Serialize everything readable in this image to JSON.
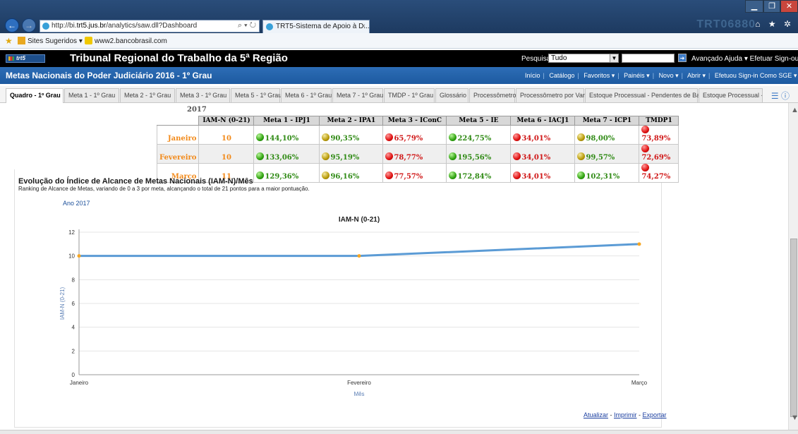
{
  "browser": {
    "url_prefix": "http://bi.",
    "url_domain": "trt5.jus.br",
    "url_rest": "/analytics/saw.dll?Dashboard",
    "url_controls": "⌕ ▾ ↻",
    "tab_title": "TRT5-Sistema de Apoio à D...",
    "tab_close": "×",
    "ghost_text": "TRT06880",
    "window_controls": {
      "minimize": "▁",
      "maximize": "❐",
      "close": "✕"
    },
    "toolbar_icons": "⌂ ★ ✲",
    "favorites": [
      "Sites Sugeridos ▾",
      "www2.bancobrasil.com"
    ]
  },
  "app_header": {
    "logo": "trt5",
    "title": "Tribunal Regional do Trabalho da 5ª Região",
    "search_label": "Pesquisar",
    "search_scope": "Tudo",
    "links": "Avançado   Ajuda ▾   Efetuar Sign-out"
  },
  "sub_header": {
    "title": "Metas Nacionais do Poder Judiciário 2016 - 1º Grau",
    "menu": [
      "Início",
      "Catálogo",
      "Favoritos ▾",
      "Painéis ▾",
      "Novo ▾",
      "Abrir ▾",
      "Efetuou Sign-in Como SGE ▾"
    ]
  },
  "tabs": [
    "Quadro - 1º Grau",
    "Meta 1 - 1º Grau",
    "Meta 2 - 1º Grau",
    "Meta 3 - 1º Grau",
    "Meta 5 - 1º Grau",
    "Meta 6 - 1º Grau",
    "Meta 7 - 1º Grau",
    "TMDP - 1º Grau",
    "Glossário",
    "Processômetro",
    "Processômetro por Vara",
    "Estoque Processual - Pendentes de Baixa",
    "Estoque Processual - I»"
  ],
  "pivot": {
    "year": "2017",
    "headers": [
      "IAM-N (0-21)",
      "Meta 1 - IPJ1",
      "Meta 2 - IPA1",
      "Meta 3 - IConC",
      "Meta 5 - IE",
      "Meta 6 - IACJ1",
      "Meta 7 - ICP1",
      "TMDP1"
    ],
    "rows": [
      {
        "month": "Janeiro",
        "iam": "10",
        "cells": [
          {
            "v": "144,10%",
            "c": "green"
          },
          {
            "v": "90,35%",
            "c": "yellow"
          },
          {
            "v": "65,79%",
            "c": "red"
          },
          {
            "v": "224,75%",
            "c": "green"
          },
          {
            "v": "34,01%",
            "c": "red"
          },
          {
            "v": "98,00%",
            "c": "yellow"
          },
          {
            "v": "73,89%",
            "c": "red"
          }
        ]
      },
      {
        "month": "Fevereiro",
        "iam": "10",
        "cells": [
          {
            "v": "133,06%",
            "c": "green"
          },
          {
            "v": "95,19%",
            "c": "yellow"
          },
          {
            "v": "78,77%",
            "c": "red"
          },
          {
            "v": "195,56%",
            "c": "green"
          },
          {
            "v": "34,01%",
            "c": "red"
          },
          {
            "v": "99,57%",
            "c": "yellow"
          },
          {
            "v": "72,69%",
            "c": "red"
          }
        ]
      },
      {
        "month": "Março",
        "iam": "11",
        "cells": [
          {
            "v": "129,36%",
            "c": "green"
          },
          {
            "v": "96,16%",
            "c": "yellow"
          },
          {
            "v": "77,57%",
            "c": "red"
          },
          {
            "v": "172,84%",
            "c": "green"
          },
          {
            "v": "34,01%",
            "c": "red"
          },
          {
            "v": "102,31%",
            "c": "green"
          },
          {
            "v": "74,27%",
            "c": "red"
          }
        ]
      }
    ]
  },
  "section": {
    "title": "Evolução do Índice de Alcance de Metas Nacionais (IAM-N)/Mês",
    "description": "Ranking de Alcance de Metas, variando de 0 a 3 por meta, alcançando o total de 21 pontos para a maior pontuação.",
    "year_label": "Ano 2017"
  },
  "chart_data": {
    "type": "line",
    "title": "IAM-N (0-21)",
    "xlabel": "Mês",
    "ylabel": "IAM-N (0-21)",
    "categories": [
      "Janeiro",
      "Fevereiro",
      "Março"
    ],
    "series": [
      {
        "values": [
          10,
          10,
          11
        ]
      }
    ],
    "ylim": [
      0,
      12
    ],
    "yticks": [
      0,
      2,
      4,
      6,
      8,
      10,
      12
    ],
    "grid": true,
    "line_color": "#5b9bd5",
    "marker_color": "#f5a623"
  },
  "footer": {
    "update": "Atualizar",
    "print": "Imprimir",
    "export": "Exportar",
    "sep": " - "
  }
}
